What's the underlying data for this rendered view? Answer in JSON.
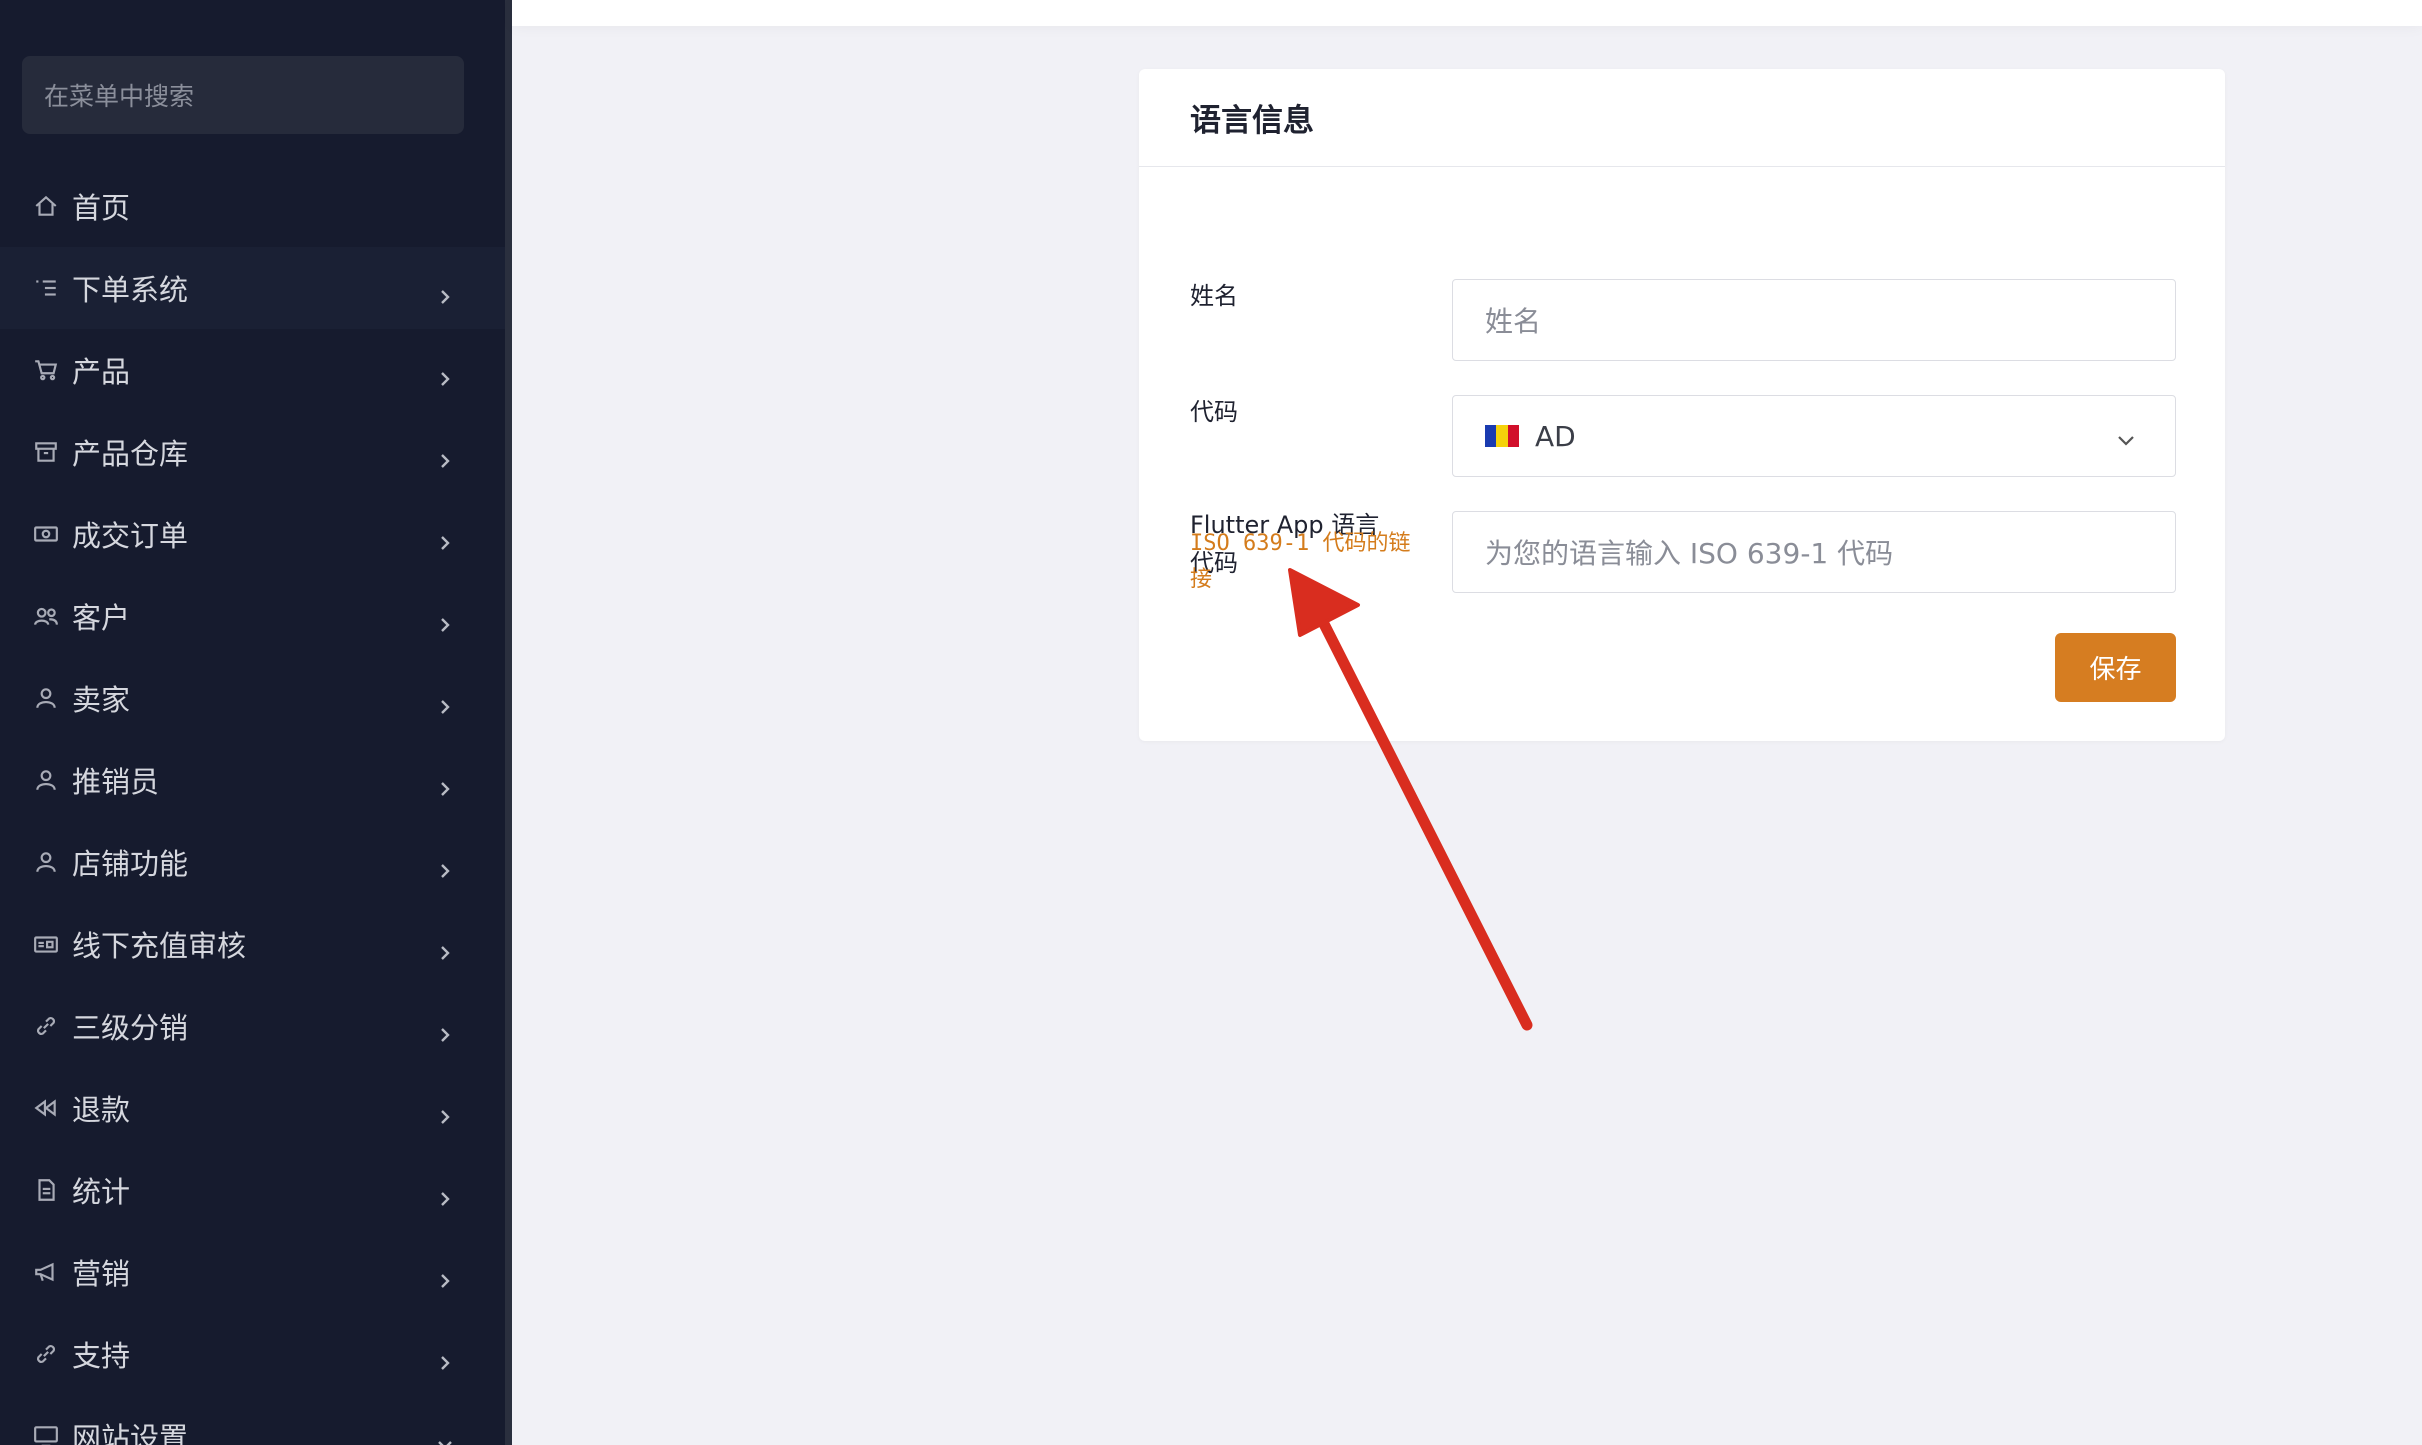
{
  "sidebar": {
    "search_placeholder": "在菜单中搜索",
    "items": [
      {
        "label": "首页",
        "icon": "home-icon",
        "has_chevron": false
      },
      {
        "label": "下单系统",
        "icon": "list-icon",
        "has_chevron": true
      },
      {
        "label": "产品",
        "icon": "cart-icon",
        "has_chevron": true
      },
      {
        "label": "产品仓库",
        "icon": "archive-icon",
        "has_chevron": true
      },
      {
        "label": "成交订单",
        "icon": "money-icon",
        "has_chevron": true
      },
      {
        "label": "客户",
        "icon": "users-icon",
        "has_chevron": true
      },
      {
        "label": "卖家",
        "icon": "user-icon",
        "has_chevron": true
      },
      {
        "label": "推销员",
        "icon": "user-icon",
        "has_chevron": true
      },
      {
        "label": "店铺功能",
        "icon": "user-icon",
        "has_chevron": true
      },
      {
        "label": "线下充值审核",
        "icon": "card-icon",
        "has_chevron": true
      },
      {
        "label": "三级分销",
        "icon": "link-icon",
        "has_chevron": true
      },
      {
        "label": "退款",
        "icon": "rewind-icon",
        "has_chevron": true
      },
      {
        "label": "统计",
        "icon": "document-icon",
        "has_chevron": true
      },
      {
        "label": "营销",
        "icon": "megaphone-icon",
        "has_chevron": true
      },
      {
        "label": "支持",
        "icon": "link-icon",
        "has_chevron": true
      },
      {
        "label": "网站设置",
        "icon": "monitor-icon",
        "has_chevron": true,
        "expanded": true
      }
    ]
  },
  "card": {
    "title": "语言信息",
    "name_label": "姓名",
    "name_placeholder": "姓名",
    "code_label": "代码",
    "code_value": "AD",
    "flutter_label": "Flutter App 语言代码",
    "flutter_placeholder": "为您的语言输入 ISO 639-1 代码",
    "iso_link": "ISO 639-1 代码的链接",
    "save_label": "保存"
  },
  "colors": {
    "sidebar_bg": "#161b2e",
    "accent": "#d67d21",
    "arrow": "#d92d1f"
  }
}
